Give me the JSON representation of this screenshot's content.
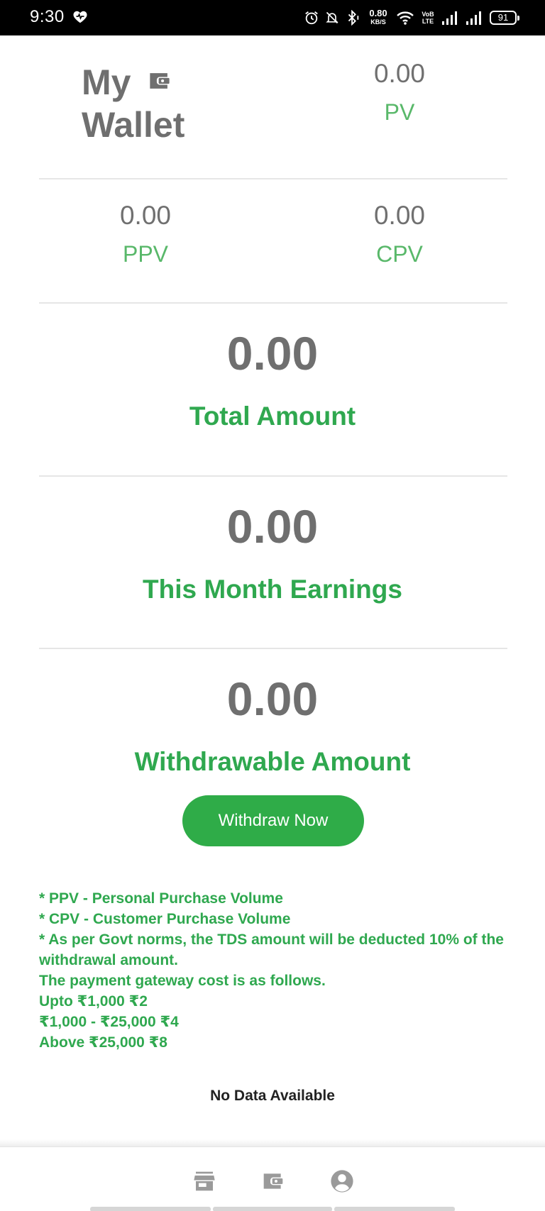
{
  "status_bar": {
    "time": "9:30",
    "net_speed": "0.80",
    "net_unit": "KB/S",
    "volte_top": "VoB",
    "volte_bottom": "LTE",
    "battery": "91",
    "icons": [
      "heart-icon",
      "alarm-icon",
      "mute-bell-icon",
      "bluetooth-icon",
      "wifi-icon",
      "signal-icon",
      "signal-icon",
      "battery-icon"
    ]
  },
  "header": {
    "title_line1": "My",
    "title_line2": "Wallet",
    "title_icon": "wallet-icon"
  },
  "stats": {
    "pv": {
      "value": "0.00",
      "label": "PV"
    },
    "ppv": {
      "value": "0.00",
      "label": "PPV"
    },
    "cpv": {
      "value": "0.00",
      "label": "CPV"
    }
  },
  "summary": {
    "total": {
      "value": "0.00",
      "label": "Total Amount"
    },
    "month": {
      "value": "0.00",
      "label": "This Month Earnings"
    },
    "withdrawable": {
      "value": "0.00",
      "label": "Withdrawable Amount"
    }
  },
  "withdraw_button": "Withdraw Now",
  "notes": [
    "* PPV - Personal Purchase Volume",
    "* CPV - Customer Purchase Volume",
    "* As per Govt norms, the TDS amount will be deducted 10% of the withdrawal amount.",
    "The payment gateway cost is as follows.",
    "Upto ₹1,000 ₹2",
    "₹1,000 - ₹25,000 ₹4",
    "Above ₹25,000 ₹8"
  ],
  "no_data": "No Data Available",
  "bottom_nav": [
    "store-icon",
    "wallet-icon",
    "account-icon"
  ],
  "colors": {
    "accent_green": "#2fa84f",
    "label_green": "#59b86a",
    "value_gray": "#707070",
    "button_green": "#2fac48"
  }
}
